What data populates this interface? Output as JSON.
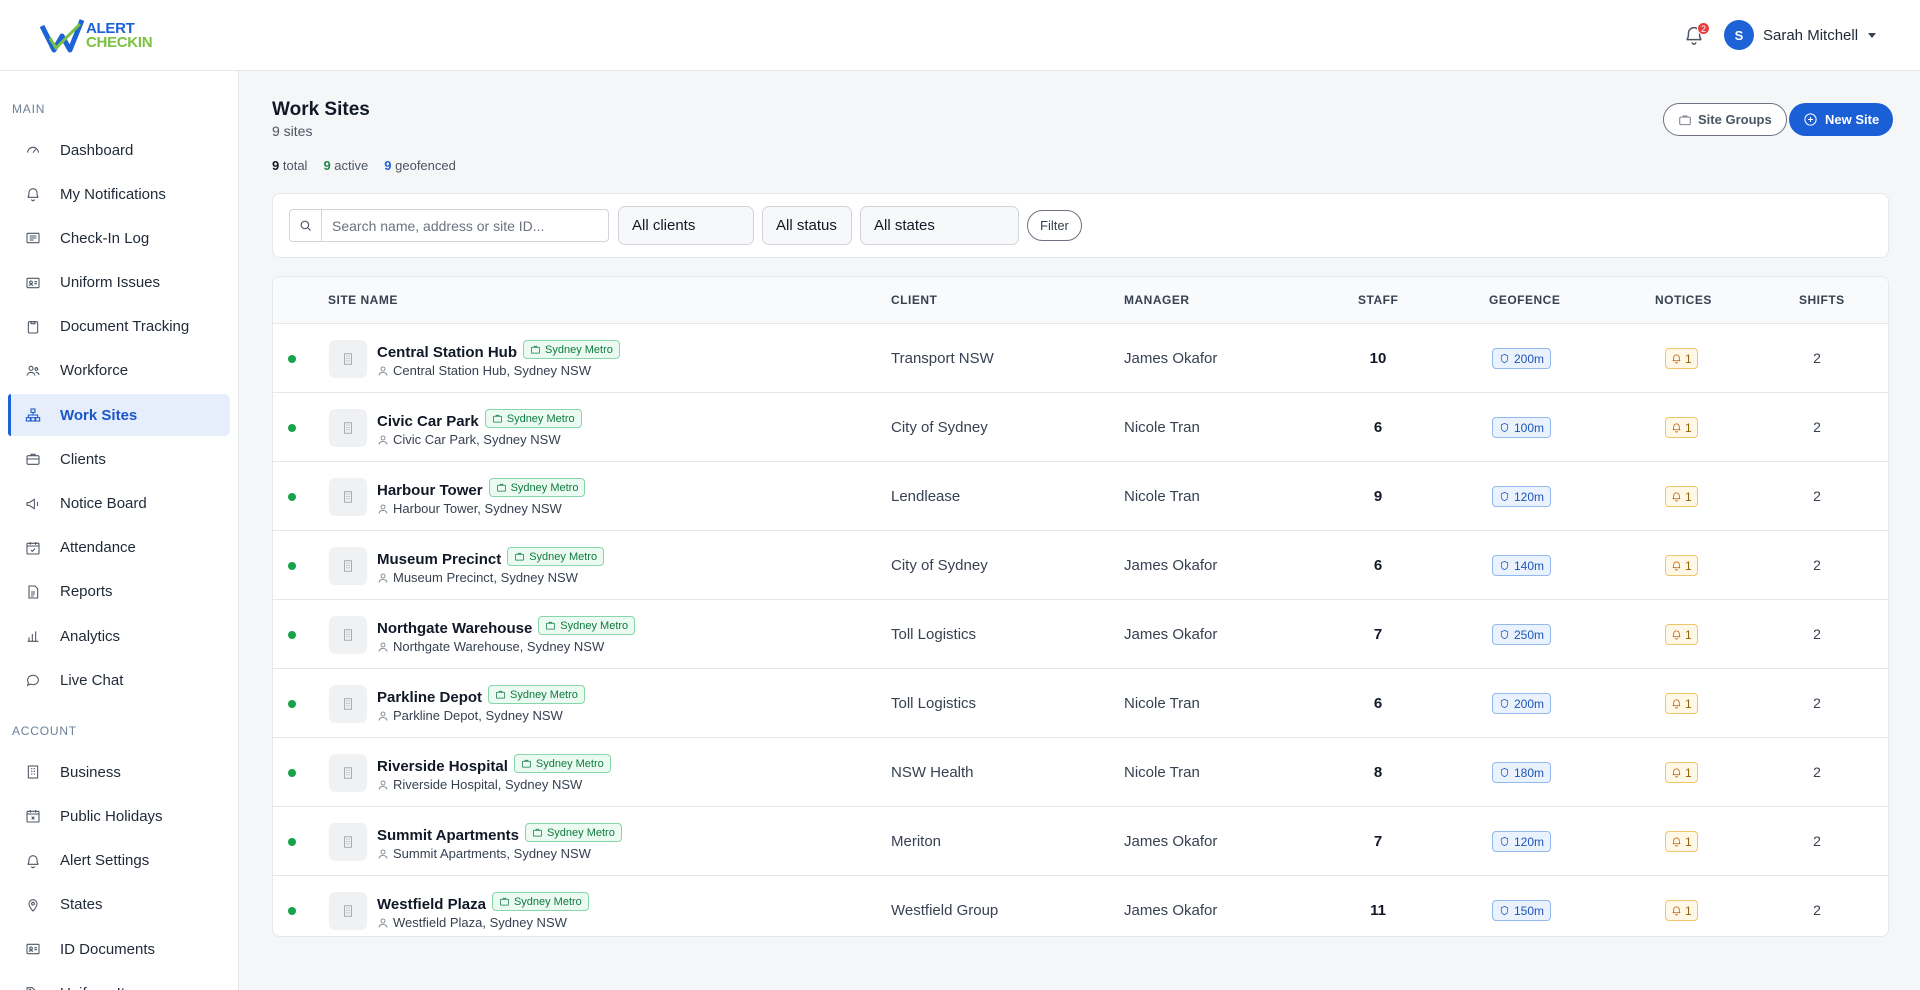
{
  "brand": {
    "line1": "ALERT",
    "line2": "CHECKIN"
  },
  "header": {
    "notification_count": "2",
    "user_initial": "S",
    "user_name": "Sarah Mitchell"
  },
  "sidebar": {
    "main_label": "MAIN",
    "account_label": "ACCOUNT",
    "main_items": [
      {
        "label": "Dashboard",
        "icon": "dashboard-icon"
      },
      {
        "label": "My Notifications",
        "icon": "bell-icon"
      },
      {
        "label": "Check-In Log",
        "icon": "log-icon"
      },
      {
        "label": "Uniform Issues",
        "icon": "id-card-icon"
      },
      {
        "label": "Document Tracking",
        "icon": "clipboard-icon"
      },
      {
        "label": "Workforce",
        "icon": "users-icon"
      },
      {
        "label": "Work Sites",
        "icon": "sitemap-icon",
        "active": true
      },
      {
        "label": "Clients",
        "icon": "briefcase-icon"
      },
      {
        "label": "Notice Board",
        "icon": "megaphone-icon"
      },
      {
        "label": "Attendance",
        "icon": "calendar-check-icon"
      },
      {
        "label": "Reports",
        "icon": "report-icon"
      },
      {
        "label": "Analytics",
        "icon": "bar-chart-icon"
      },
      {
        "label": "Live Chat",
        "icon": "chat-icon"
      }
    ],
    "account_items": [
      {
        "label": "Business",
        "icon": "building-icon"
      },
      {
        "label": "Public Holidays",
        "icon": "calendar-x-icon"
      },
      {
        "label": "Alert Settings",
        "icon": "bell-icon"
      },
      {
        "label": "States",
        "icon": "map-pin-icon"
      },
      {
        "label": "ID Documents",
        "icon": "id-card-icon"
      },
      {
        "label": "Uniform Items",
        "icon": "tag-icon"
      }
    ]
  },
  "page": {
    "title": "Work Sites",
    "subtitle": "9 sites",
    "stats": {
      "total": "9",
      "total_label": "total",
      "active": "9",
      "active_label": "active",
      "geofenced": "9",
      "geofenced_label": "geofenced"
    },
    "site_groups_label": "Site Groups",
    "new_site_label": "New Site"
  },
  "filters": {
    "search_placeholder": "Search name, address or site ID...",
    "clients": "All clients",
    "status": "All status",
    "states": "All states",
    "filter_label": "Filter"
  },
  "table": {
    "columns": [
      "SITE NAME",
      "CLIENT",
      "MANAGER",
      "STAFF",
      "GEOFENCE",
      "NOTICES",
      "SHIFTS"
    ],
    "rows": [
      {
        "name": "Central Station Hub",
        "group": "Sydney Metro",
        "address": "Central Station Hub, Sydney NSW",
        "client": "Transport NSW",
        "manager": "James Okafor",
        "staff": "10",
        "geofence": "200m",
        "notices": "1",
        "shifts": "2"
      },
      {
        "name": "Civic Car Park",
        "group": "Sydney Metro",
        "address": "Civic Car Park, Sydney NSW",
        "client": "City of Sydney",
        "manager": "Nicole Tran",
        "staff": "6",
        "geofence": "100m",
        "notices": "1",
        "shifts": "2"
      },
      {
        "name": "Harbour Tower",
        "group": "Sydney Metro",
        "address": "Harbour Tower, Sydney NSW",
        "client": "Lendlease",
        "manager": "Nicole Tran",
        "staff": "9",
        "geofence": "120m",
        "notices": "1",
        "shifts": "2"
      },
      {
        "name": "Museum Precinct",
        "group": "Sydney Metro",
        "address": "Museum Precinct, Sydney NSW",
        "client": "City of Sydney",
        "manager": "James Okafor",
        "staff": "6",
        "geofence": "140m",
        "notices": "1",
        "shifts": "2"
      },
      {
        "name": "Northgate Warehouse",
        "group": "Sydney Metro",
        "address": "Northgate Warehouse, Sydney NSW",
        "client": "Toll Logistics",
        "manager": "James Okafor",
        "staff": "7",
        "geofence": "250m",
        "notices": "1",
        "shifts": "2"
      },
      {
        "name": "Parkline Depot",
        "group": "Sydney Metro",
        "address": "Parkline Depot, Sydney NSW",
        "client": "Toll Logistics",
        "manager": "Nicole Tran",
        "staff": "6",
        "geofence": "200m",
        "notices": "1",
        "shifts": "2"
      },
      {
        "name": "Riverside Hospital",
        "group": "Sydney Metro",
        "address": "Riverside Hospital, Sydney NSW",
        "client": "NSW Health",
        "manager": "Nicole Tran",
        "staff": "8",
        "geofence": "180m",
        "notices": "1",
        "shifts": "2"
      },
      {
        "name": "Summit Apartments",
        "group": "Sydney Metro",
        "address": "Summit Apartments, Sydney NSW",
        "client": "Meriton",
        "manager": "James Okafor",
        "staff": "7",
        "geofence": "120m",
        "notices": "1",
        "shifts": "2"
      },
      {
        "name": "Westfield Plaza",
        "group": "Sydney Metro",
        "address": "Westfield Plaza, Sydney NSW",
        "client": "Westfield Group",
        "manager": "James Okafor",
        "staff": "11",
        "geofence": "150m",
        "notices": "1",
        "shifts": "2"
      }
    ]
  },
  "colors": {
    "accent": "#1a5fd6",
    "active_dot": "#16a34a",
    "sidebar_active_bg": "#e6eefb"
  }
}
